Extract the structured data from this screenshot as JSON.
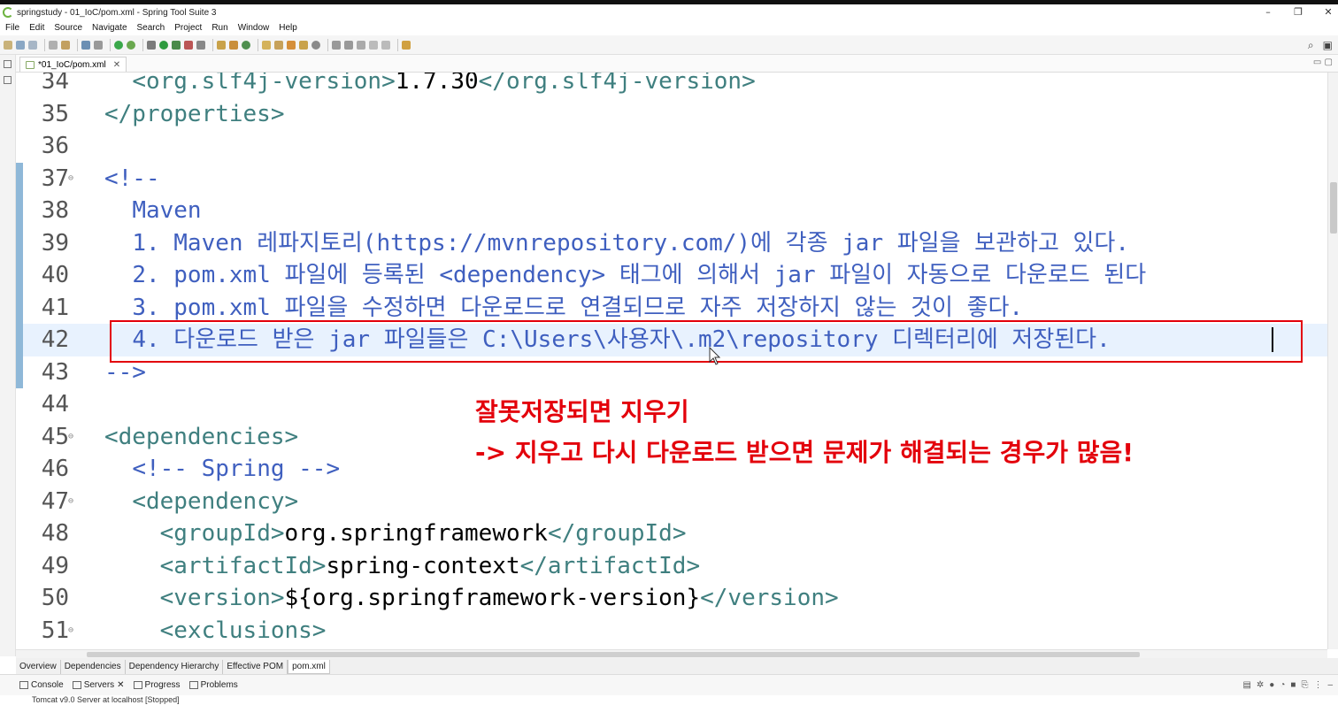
{
  "window": {
    "title": "springstudy - 01_IoC/pom.xml - Spring Tool Suite 3",
    "controls": {
      "minimize": "–",
      "maximize": "❐",
      "close": "✕"
    }
  },
  "menu": [
    "File",
    "Edit",
    "Source",
    "Navigate",
    "Search",
    "Project",
    "Run",
    "Window",
    "Help"
  ],
  "editor": {
    "tab_label": "*01_IoC/pom.xml",
    "tab_close": "✕",
    "lines": [
      {
        "n": "34",
        "fold": "",
        "parts": [
          {
            "c": "tag",
            "t": "<org.slf4j-version>"
          },
          {
            "c": "text",
            "t": "1.7.30"
          },
          {
            "c": "tag",
            "t": "</org.slf4j-version>"
          }
        ],
        "indent": "  "
      },
      {
        "n": "35",
        "fold": "",
        "parts": [
          {
            "c": "tag",
            "t": "</properties>"
          }
        ],
        "indent": ""
      },
      {
        "n": "36",
        "fold": "",
        "parts": [],
        "indent": ""
      },
      {
        "n": "37",
        "fold": "⊖",
        "parts": [
          {
            "c": "comment",
            "t": "<!--"
          }
        ],
        "indent": ""
      },
      {
        "n": "38",
        "fold": "",
        "parts": [
          {
            "c": "comment",
            "t": "Maven"
          }
        ],
        "indent": "  "
      },
      {
        "n": "39",
        "fold": "",
        "parts": [
          {
            "c": "comment",
            "t": "1. Maven 레파지토리(https://mvnrepository.com/)에 각종 jar 파일을 보관하고 있다."
          }
        ],
        "indent": "  "
      },
      {
        "n": "40",
        "fold": "",
        "parts": [
          {
            "c": "comment",
            "t": "2. pom.xml 파일에 등록된 <dependency> 태그에 의해서 jar 파일이 자동으로 다운로드 된다"
          }
        ],
        "indent": "  "
      },
      {
        "n": "41",
        "fold": "",
        "parts": [
          {
            "c": "comment",
            "t": "3. pom.xml 파일을 수정하면 다운로드로 연결되므로 자주 저장하지 않는 것이 좋다."
          }
        ],
        "indent": "  "
      },
      {
        "n": "42",
        "fold": "",
        "parts": [
          {
            "c": "comment",
            "t": "4. 다운로드 받은 jar 파일들은 C:\\Users\\사용자\\.m2\\repository 디렉터리에 저장된다."
          }
        ],
        "indent": "  "
      },
      {
        "n": "43",
        "fold": "",
        "parts": [
          {
            "c": "comment",
            "t": "-->"
          }
        ],
        "indent": ""
      },
      {
        "n": "44",
        "fold": "",
        "parts": [],
        "indent": ""
      },
      {
        "n": "45",
        "fold": "⊖",
        "parts": [
          {
            "c": "tag",
            "t": "<dependencies>"
          }
        ],
        "indent": ""
      },
      {
        "n": "46",
        "fold": "",
        "parts": [
          {
            "c": "comment",
            "t": "<!-- Spring -->"
          }
        ],
        "indent": "  "
      },
      {
        "n": "47",
        "fold": "⊖",
        "parts": [
          {
            "c": "tag",
            "t": "<dependency>"
          }
        ],
        "indent": "  "
      },
      {
        "n": "48",
        "fold": "",
        "parts": [
          {
            "c": "tag",
            "t": "<groupId>"
          },
          {
            "c": "text",
            "t": "org.springframework"
          },
          {
            "c": "tag",
            "t": "</groupId>"
          }
        ],
        "indent": "    "
      },
      {
        "n": "49",
        "fold": "",
        "parts": [
          {
            "c": "tag",
            "t": "<artifactId>"
          },
          {
            "c": "text",
            "t": "spring-context"
          },
          {
            "c": "tag",
            "t": "</artifactId>"
          }
        ],
        "indent": "    "
      },
      {
        "n": "50",
        "fold": "",
        "parts": [
          {
            "c": "tag",
            "t": "<version>"
          },
          {
            "c": "text",
            "t": "${org.springframework-version}"
          },
          {
            "c": "tag",
            "t": "</version>"
          }
        ],
        "indent": "    "
      },
      {
        "n": "51",
        "fold": "⊖",
        "parts": [
          {
            "c": "tag",
            "t": "<exclusions>"
          }
        ],
        "indent": "    "
      }
    ],
    "current_line": "42"
  },
  "annotation": {
    "line1": "잘못저장되면 지우기",
    "line2": "-> 지우고 다시 다운로드 받으면 문제가 해결되는 경우가 많음!",
    "color": "#e3000b"
  },
  "pom_tabs": [
    "Overview",
    "Dependencies",
    "Dependency Hierarchy",
    "Effective POM",
    "pom.xml"
  ],
  "pom_tab_active": "pom.xml",
  "bottom_views": [
    {
      "label": "Console",
      "icon": "console-icon"
    },
    {
      "label": "Servers",
      "icon": "servers-icon",
      "close": "✕"
    },
    {
      "label": "Progress",
      "icon": "progress-icon"
    },
    {
      "label": "Problems",
      "icon": "problems-icon"
    }
  ],
  "server_entry": "Tomcat v9.0 Server at localhost  [Stopped]",
  "colors": {
    "tag": "#3f7f7f",
    "comment": "#3f5fbf",
    "current_line": "#e8f2fe"
  }
}
